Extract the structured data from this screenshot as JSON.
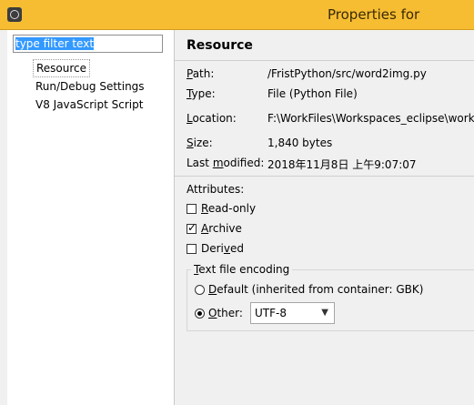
{
  "window": {
    "title": "Properties for"
  },
  "filter": {
    "value": "type filter text"
  },
  "tree": {
    "items": [
      {
        "label": "Resource"
      },
      {
        "label": "Run/Debug Settings"
      },
      {
        "label": "V8 JavaScript Script"
      }
    ]
  },
  "page": {
    "title": "Resource",
    "path_label_u": "P",
    "path_label_rest": "ath:",
    "path_value": "/FristPython/src/word2img.py",
    "type_label_u": "T",
    "type_label_rest": "ype:",
    "type_value": "File  (Python File)",
    "location_label_u": "L",
    "location_label_rest": "ocation:",
    "location_value": "F:\\WorkFiles\\Workspaces_eclipse\\work",
    "size_label_u": "S",
    "size_label_rest": "ize:",
    "size_value": "1,840  bytes",
    "modified_label_pre": "Last ",
    "modified_label_u": "m",
    "modified_label_rest": "odified:",
    "modified_value": "2018年11月8日 上午9:07:07"
  },
  "attributes": {
    "heading": "Attributes:",
    "readonly": {
      "u": "R",
      "rest": "ead-only",
      "checked": false
    },
    "archive": {
      "u": "A",
      "rest": "rchive",
      "checked": true
    },
    "derived": {
      "pre": "Deri",
      "u": "v",
      "rest": "ed",
      "checked": false
    }
  },
  "encoding": {
    "title_u": "T",
    "title_rest": "ext file encoding",
    "default_u": "D",
    "default_rest": "efault (inherited from container: GBK)",
    "other_u": "O",
    "other_rest": "ther:",
    "selected": "other",
    "other_value": "UTF-8"
  },
  "colors": {
    "titlebar": "#f6bd33",
    "selection": "#3399ff"
  }
}
